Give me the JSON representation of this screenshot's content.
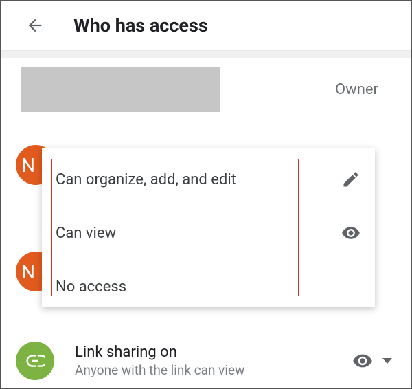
{
  "header": {
    "title": "Who has access"
  },
  "owner": {
    "label": "Owner"
  },
  "avatar_initial": "N",
  "link_sharing": {
    "title": "Link sharing on",
    "subtitle": "Anyone with the link can view"
  },
  "permission_menu": {
    "organize": "Can organize, add, and edit",
    "view": "Can view",
    "no_access": "No access"
  }
}
